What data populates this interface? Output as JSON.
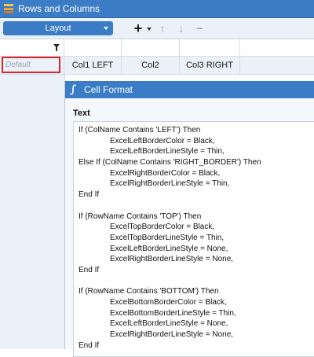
{
  "window": {
    "title": "Rows and Columns"
  },
  "toolbar": {
    "layout_label": "Layout",
    "add": "+",
    "up": "↑",
    "down": "↓",
    "remove": "−"
  },
  "grid": {
    "default_row_label": "Default",
    "columns": [
      "Col1 LEFT",
      "Col2",
      "Col3 RIGHT"
    ]
  },
  "panel": {
    "title": "Cell Format",
    "text_label": "Text",
    "lines": [
      {
        "t": "If (ColName Contains 'LEFT') Then",
        "i": false
      },
      {
        "t": "ExcelLeftBorderColor = Black,",
        "i": true
      },
      {
        "t": "ExcelLeftBorderLineStyle = Thin,",
        "i": true
      },
      {
        "t": "Else If (ColName Contains 'RIGHT_BORDER') Then",
        "i": false
      },
      {
        "t": "ExcelRightBorderColor = Black,",
        "i": true
      },
      {
        "t": "ExcelRightBorderLineStyle = Thin,",
        "i": true
      },
      {
        "t": "End If",
        "i": false
      },
      {
        "t": "",
        "i": false
      },
      {
        "t": "If (RowName Contains 'TOP') Then",
        "i": false
      },
      {
        "t": "ExcelTopBorderColor = Black,",
        "i": true
      },
      {
        "t": "ExcelTopBorderLineStyle = Thin,",
        "i": true
      },
      {
        "t": "ExcelLeftBorderLineStyle = None,",
        "i": true
      },
      {
        "t": "ExcelRightBorderLineStyle = None,",
        "i": true
      },
      {
        "t": "End If",
        "i": false
      },
      {
        "t": "",
        "i": false
      },
      {
        "t": "If (RowName Contains 'BOTTOM') Then",
        "i": false
      },
      {
        "t": "ExcelBottomBorderColor = Black,",
        "i": true
      },
      {
        "t": "ExcelBottomBorderLineStyle = Thin,",
        "i": true
      },
      {
        "t": "ExcelLeftBorderLineStyle = None,",
        "i": true
      },
      {
        "t": "ExcelRightBorderLineStyle = None,",
        "i": true
      },
      {
        "t": "End If",
        "i": false
      }
    ]
  },
  "colors": {
    "accent": "#3a7cc6",
    "selection_border": "#d9242b"
  }
}
